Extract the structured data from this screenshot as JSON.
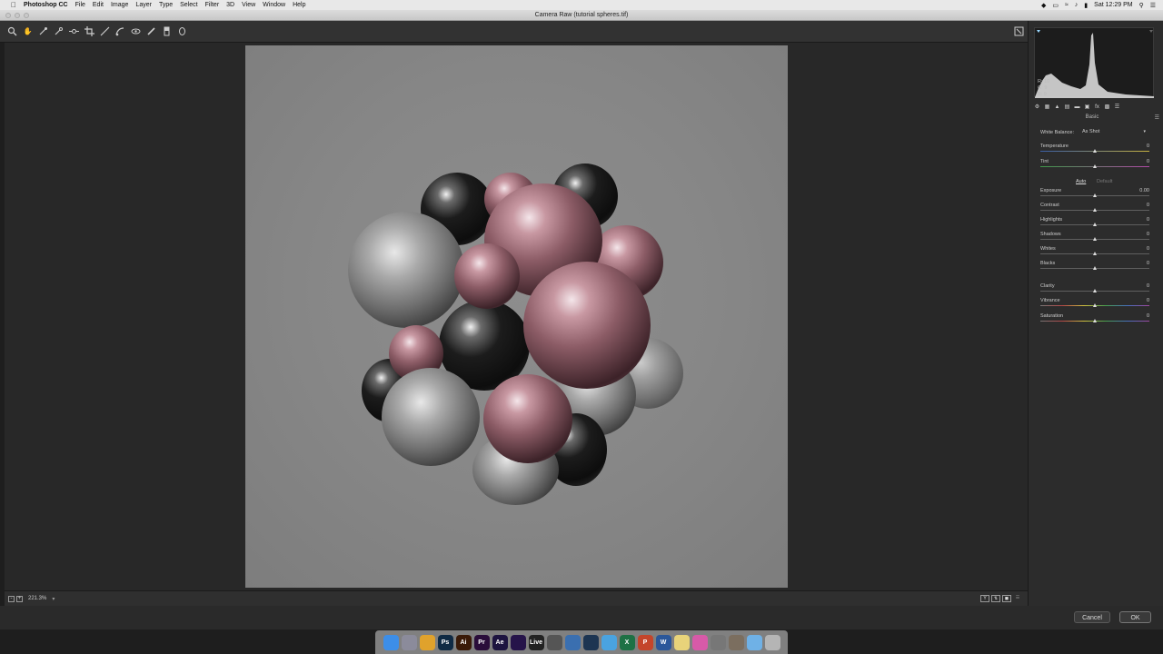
{
  "menubar": {
    "app_name": "Photoshop CC",
    "items": [
      "File",
      "Edit",
      "Image",
      "Layer",
      "Type",
      "Select",
      "Filter",
      "3D",
      "View",
      "Window",
      "Help"
    ],
    "clock": "Sat 12:29 PM"
  },
  "window": {
    "title": "Camera Raw (tutorial spheres.tif)"
  },
  "toolbar": {
    "tools": [
      "zoom-tool",
      "hand-tool",
      "white-balance-tool",
      "color-sampler-tool",
      "targeted-adjustment-tool",
      "crop-tool",
      "straighten-tool",
      "spot-removal-tool",
      "red-eye-tool",
      "adjustment-brush-tool",
      "graduated-filter-tool",
      "radial-filter-tool"
    ]
  },
  "status": {
    "zoom": "221.3%"
  },
  "panel": {
    "rgb": {
      "r_label": "R:",
      "r": "10",
      "g_label": "G:",
      "g": "9",
      "b_label": "B:",
      "b": "9"
    },
    "title": "Basic",
    "white_balance_label": "White Balance:",
    "white_balance_value": "As Shot",
    "auto_label": "Auto",
    "default_label": "Default",
    "sliders": [
      {
        "label": "Temperature",
        "value": "0",
        "pos": 0.5
      },
      {
        "label": "Tint",
        "value": "0",
        "pos": 0.5
      },
      {
        "label": "Exposure",
        "value": "0.00",
        "pos": 0.5
      },
      {
        "label": "Contrast",
        "value": "0",
        "pos": 0.5
      },
      {
        "label": "Highlights",
        "value": "0",
        "pos": 0.5
      },
      {
        "label": "Shadows",
        "value": "0",
        "pos": 0.5
      },
      {
        "label": "Whites",
        "value": "0",
        "pos": 0.5
      },
      {
        "label": "Blacks",
        "value": "0",
        "pos": 0.5
      },
      {
        "label": "Clarity",
        "value": "0",
        "pos": 0.5
      },
      {
        "label": "Vibrance",
        "value": "0",
        "pos": 0.5
      },
      {
        "label": "Saturation",
        "value": "0",
        "pos": 0.5
      }
    ]
  },
  "buttons": {
    "cancel": "Cancel",
    "ok": "OK"
  },
  "dock": {
    "apps": [
      {
        "name": "Finder",
        "color": "#3d8ee8",
        "label": ""
      },
      {
        "name": "Launchpad",
        "color": "#8b8b9b",
        "label": ""
      },
      {
        "name": "Chrome",
        "color": "#e0a22c",
        "label": ""
      },
      {
        "name": "Photoshop",
        "color": "#0f2a44",
        "label": "Ps"
      },
      {
        "name": "Illustrator",
        "color": "#3a1a08",
        "label": "Ai"
      },
      {
        "name": "Premiere",
        "color": "#2a0d3a",
        "label": "Pr"
      },
      {
        "name": "After Effects",
        "color": "#1d1440",
        "label": "Ae"
      },
      {
        "name": "Media Encoder",
        "color": "#26144a",
        "label": ""
      },
      {
        "name": "Ableton Live",
        "color": "#222",
        "label": "Live"
      },
      {
        "name": "Preview",
        "color": "#555",
        "label": ""
      },
      {
        "name": "App",
        "color": "#3a6fb0",
        "label": ""
      },
      {
        "name": "Cinema 4D",
        "color": "#1d3552",
        "label": ""
      },
      {
        "name": "Messages",
        "color": "#4aa3e0",
        "label": ""
      },
      {
        "name": "Excel",
        "color": "#1e7145",
        "label": "X"
      },
      {
        "name": "PowerPoint",
        "color": "#c4452b",
        "label": "P"
      },
      {
        "name": "Word",
        "color": "#2b579a",
        "label": "W"
      },
      {
        "name": "Notes",
        "color": "#e8d37a",
        "label": ""
      },
      {
        "name": "iTunes",
        "color": "#d75aa8",
        "label": ""
      },
      {
        "name": "System Preferences",
        "color": "#777",
        "label": ""
      },
      {
        "name": "App Store",
        "color": "#7b6e5f",
        "label": ""
      },
      {
        "name": "Folder",
        "color": "#6fb1e6",
        "label": ""
      },
      {
        "name": "Trash",
        "color": "#b5b5b5",
        "label": ""
      }
    ]
  }
}
